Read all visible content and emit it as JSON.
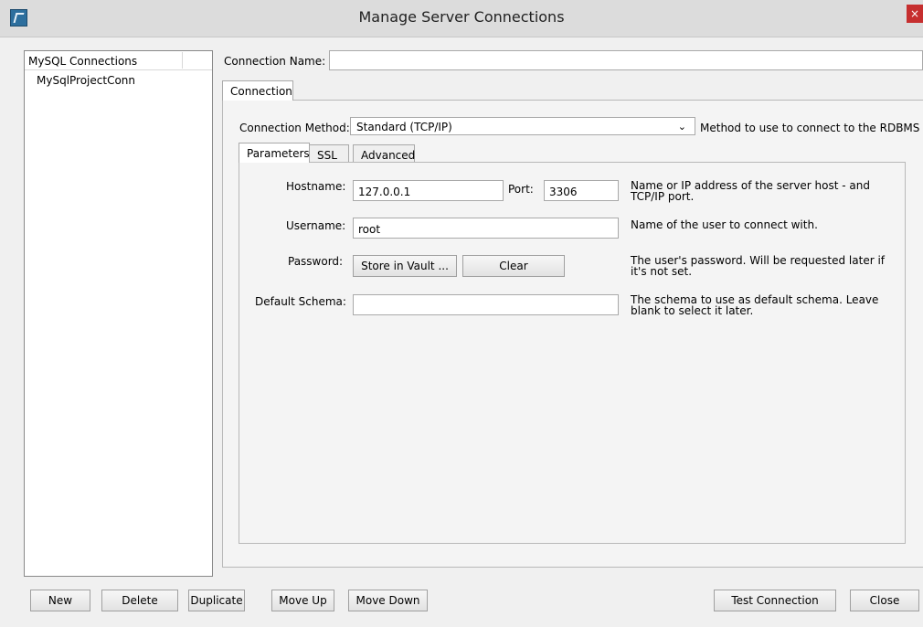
{
  "window": {
    "title": "Manage Server Connections",
    "close_glyph": "×"
  },
  "sidebar": {
    "header": "MySQL Connections",
    "items": [
      "MySqlProjectConn"
    ]
  },
  "connection": {
    "name_label": "Connection Name:",
    "name_value": "",
    "tab_connection": "Connection",
    "method_label": "Connection Method:",
    "method_value": "Standard (TCP/IP)",
    "method_help": "Method to use to connect to the RDBMS",
    "subtabs": [
      "Parameters",
      "SSL",
      "Advanced"
    ],
    "hostname_label": "Hostname:",
    "hostname_value": "127.0.0.1",
    "port_label": "Port:",
    "port_value": "3306",
    "hostname_help": "Name or IP address of the server host - and TCP/IP port.",
    "username_label": "Username:",
    "username_value": "root",
    "username_help": "Name of the user to connect with.",
    "password_label": "Password:",
    "store_vault_label": "Store in Vault ...",
    "clear_label": "Clear",
    "password_help": "The user's password. Will be requested later if it's not set.",
    "schema_label": "Default Schema:",
    "schema_value": "",
    "schema_help": "The schema to use as default schema. Leave blank to select it later."
  },
  "footer": {
    "new": "New",
    "delete": "Delete",
    "duplicate": "Duplicate",
    "move_up": "Move Up",
    "move_down": "Move Down",
    "test": "Test Connection",
    "close": "Close"
  },
  "icons": {
    "app": "mysql-workbench-icon",
    "dropdown": "chevron-down-icon",
    "close": "close-icon"
  }
}
